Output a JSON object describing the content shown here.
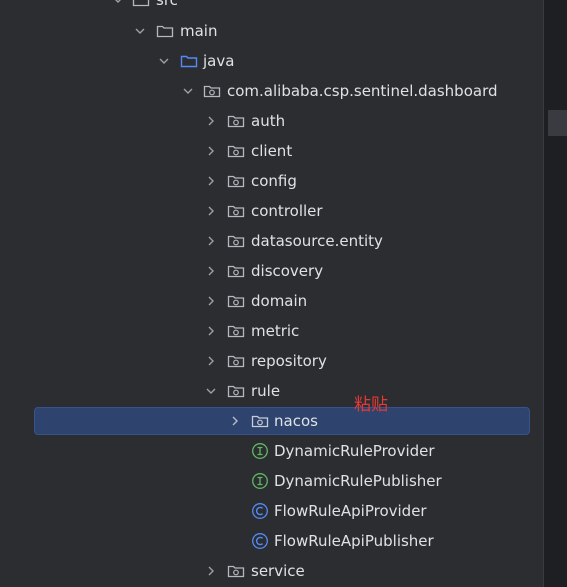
{
  "tree": {
    "src": "src",
    "main": "main",
    "java": "java",
    "package": "com.alibaba.csp.sentinel.dashboard",
    "auth": "auth",
    "client": "client",
    "config": "config",
    "controller": "controller",
    "datasource": "datasource.entity",
    "discovery": "discovery",
    "domain": "domain",
    "metric": "metric",
    "repository": "repository",
    "rule": "rule",
    "nacos": "nacos",
    "dynamic_provider": "DynamicRuleProvider",
    "dynamic_publisher": "DynamicRulePublisher",
    "flow_provider": "FlowRuleApiProvider",
    "flow_publisher": "FlowRuleApiPublisher",
    "service": "service"
  },
  "annotation": "粘贴",
  "colors": {
    "background": "#2b2d30",
    "selection": "#2e436e",
    "interface_icon": "#5fb865",
    "class_icon": "#548af7",
    "annotation": "#e53935"
  }
}
